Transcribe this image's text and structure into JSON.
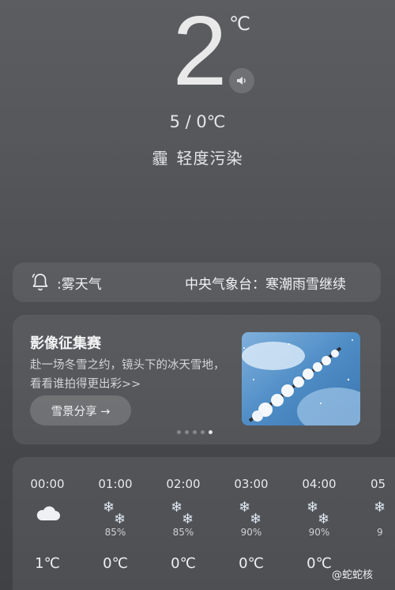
{
  "current": {
    "temperature": "2",
    "unit": "℃",
    "hi_lo": "5 / 0℃",
    "condition": "霾",
    "air_quality": "轻度污染"
  },
  "alert": {
    "left_text": ":雾天气",
    "right_text": "中央气象台：寒潮雨雪继续"
  },
  "promo": {
    "title": "影像征集赛",
    "description": "赴一场冬雪之约，镜头下的冰天雪地，看看谁拍得更出彩>>",
    "button_label": "雪景分享 →",
    "page_count": 5,
    "active_page": 5
  },
  "hourly": [
    {
      "time": "00:00",
      "icon": "cloud-icon",
      "precip": "",
      "temp": "1℃"
    },
    {
      "time": "01:00",
      "icon": "snow-icon",
      "precip": "85%",
      "temp": "0℃"
    },
    {
      "time": "02:00",
      "icon": "snow-icon",
      "precip": "85%",
      "temp": "0℃"
    },
    {
      "time": "03:00",
      "icon": "snow-icon",
      "precip": "90%",
      "temp": "0℃"
    },
    {
      "time": "04:00",
      "icon": "snow-icon",
      "precip": "90%",
      "temp": "0℃"
    },
    {
      "time": "05",
      "icon": "snow-icon",
      "precip": "9",
      "temp": ""
    }
  ],
  "watermark": "@蛇蛇核"
}
